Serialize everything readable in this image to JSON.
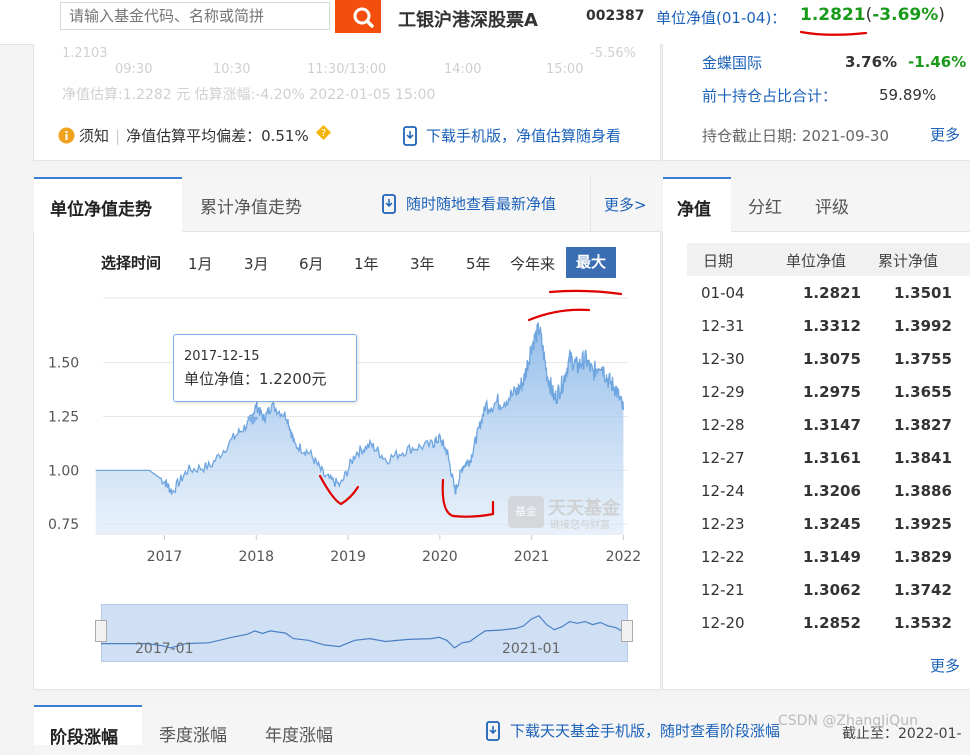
{
  "search": {
    "placeholder": "请输入基金代码、名称或简拼"
  },
  "header": {
    "fund_name": "工银沪港深股票A",
    "fund_code": "002387",
    "nav_label": "单位净值(01-04)：",
    "nav_value": "1.2821",
    "nav_change": "-3.69%",
    "paren_open": "(",
    "paren_close": ")"
  },
  "top_left_panel": {
    "faded_line1_left": "1.2103",
    "faded_line1_right": "-5.56%",
    "faded_ticks": [
      "09:30",
      "10:30",
      "11:30/13:00",
      "14:00",
      "15:00"
    ],
    "faded_estimate": "净值估算:1.2282 元  估算涨幅:-4.20% 2022-01-05 15:00",
    "notice_label": "须知",
    "deviation_text": "净值估算平均偏差：0.51%",
    "download_text": "下载手机版，净值估算随身看"
  },
  "top_right_panel": {
    "holding_name": "金蝶国际",
    "holding_weight": "3.76%",
    "holding_change": "-1.46%",
    "top10_label": "前十持仓占比合计：",
    "top10_value": "59.89%",
    "deadline_label": "持仓截止日期: 2021-09-30",
    "more": "更多"
  },
  "chart_panel": {
    "tabs": [
      "单位净值走势",
      "累计净值走势"
    ],
    "app_link": "随时随地查看最新净值",
    "more": "更多>",
    "range_label": "选择时间",
    "ranges": [
      "1月",
      "3月",
      "6月",
      "1年",
      "3年",
      "5年",
      "今年来",
      "最大"
    ],
    "tooltip_date": "2017-12-15",
    "tooltip_value": "单位净值：1.2200元",
    "watermark_main": "天天基金",
    "watermark_sub": "链接您与财富",
    "watermark_badge": "基金",
    "navigator_labels": [
      "2017-01",
      "2021-01"
    ]
  },
  "chart_data": {
    "type": "area",
    "title": "",
    "xlabel": "",
    "ylabel": "",
    "x_ticks": [
      "2017",
      "2018",
      "2019",
      "2020",
      "2021",
      "2022"
    ],
    "y_ticks": [
      "1.50",
      "1.25",
      "1.00",
      "0.75"
    ],
    "ylim": [
      0.7,
      1.8
    ],
    "grid": true,
    "series": [
      {
        "points": [
          [
            "2016-04",
            1.0
          ],
          [
            "2016-08",
            1.0
          ],
          [
            "2016-11",
            1.0
          ],
          [
            "2017-01",
            0.95
          ],
          [
            "2017-02",
            0.9
          ],
          [
            "2017-04",
            1.0
          ],
          [
            "2017-07",
            1.02
          ],
          [
            "2017-10",
            1.15
          ],
          [
            "2017-12",
            1.22
          ],
          [
            "2018-01",
            1.3
          ],
          [
            "2018-02",
            1.24
          ],
          [
            "2018-03",
            1.3
          ],
          [
            "2018-05",
            1.25
          ],
          [
            "2018-06",
            1.12
          ],
          [
            "2018-08",
            1.08
          ],
          [
            "2018-10",
            0.97
          ],
          [
            "2018-12",
            0.93
          ],
          [
            "2019-02",
            1.08
          ],
          [
            "2019-04",
            1.12
          ],
          [
            "2019-06",
            1.05
          ],
          [
            "2019-09",
            1.1
          ],
          [
            "2019-12",
            1.12
          ],
          [
            "2020-01",
            1.15
          ],
          [
            "2020-02",
            1.08
          ],
          [
            "2020-03",
            0.9
          ],
          [
            "2020-04",
            1.02
          ],
          [
            "2020-05",
            1.05
          ],
          [
            "2020-06",
            1.18
          ],
          [
            "2020-07",
            1.3
          ],
          [
            "2020-09",
            1.32
          ],
          [
            "2020-11",
            1.36
          ],
          [
            "2020-12",
            1.42
          ],
          [
            "2021-01",
            1.58
          ],
          [
            "2021-02",
            1.66
          ],
          [
            "2021-03",
            1.45
          ],
          [
            "2021-04",
            1.33
          ],
          [
            "2021-05",
            1.4
          ],
          [
            "2021-06",
            1.52
          ],
          [
            "2021-07",
            1.48
          ],
          [
            "2021-08",
            1.52
          ],
          [
            "2021-09",
            1.45
          ],
          [
            "2021-10",
            1.5
          ],
          [
            "2021-11",
            1.42
          ],
          [
            "2021-12",
            1.38
          ],
          [
            "2022-01",
            1.28
          ]
        ]
      }
    ],
    "tooltip_point": {
      "x": "2017-12-15",
      "y": 1.22
    }
  },
  "nav_table": {
    "tabs": [
      "净值",
      "分红",
      "评级"
    ],
    "headers": [
      "日期",
      "单位净值",
      "累计净值"
    ],
    "rows": [
      [
        "01-04",
        "1.2821",
        "1.3501"
      ],
      [
        "12-31",
        "1.3312",
        "1.3992"
      ],
      [
        "12-30",
        "1.3075",
        "1.3755"
      ],
      [
        "12-29",
        "1.2975",
        "1.3655"
      ],
      [
        "12-28",
        "1.3147",
        "1.3827"
      ],
      [
        "12-27",
        "1.3161",
        "1.3841"
      ],
      [
        "12-24",
        "1.3206",
        "1.3886"
      ],
      [
        "12-23",
        "1.3245",
        "1.3925"
      ],
      [
        "12-22",
        "1.3149",
        "1.3829"
      ],
      [
        "12-21",
        "1.3062",
        "1.3742"
      ],
      [
        "12-20",
        "1.2852",
        "1.3532"
      ]
    ],
    "more": "更多"
  },
  "bottom_panel": {
    "tabs": [
      "阶段涨幅",
      "季度涨幅",
      "年度涨幅"
    ],
    "download_text": "下载天天基金手机版，随时查看阶段涨幅",
    "deadline_text": "截止至：2022-01-"
  },
  "watermark": "CSDN @ZhangJiQun",
  "colors": {
    "accent_orange": "#f44e0f",
    "link_blue": "#1c62b9",
    "down_green": "#1a9a1a",
    "chart_blue": "#6fa6e0",
    "annotation_red": "#e00000"
  }
}
